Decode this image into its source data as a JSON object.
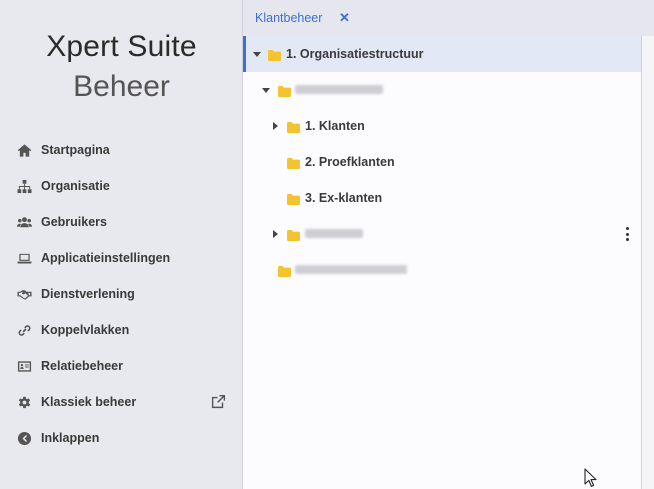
{
  "brand": {
    "line1": "Xpert Suite",
    "line2": "Beheer"
  },
  "nav": [
    {
      "id": "startpagina",
      "label": "Startpagina",
      "icon": "home-icon"
    },
    {
      "id": "organisatie",
      "label": "Organisatie",
      "icon": "sitemap-icon"
    },
    {
      "id": "gebruikers",
      "label": "Gebruikers",
      "icon": "users-icon"
    },
    {
      "id": "applicatieinstellingen",
      "label": "Applicatieinstellingen",
      "icon": "laptop-icon"
    },
    {
      "id": "dienstverlening",
      "label": "Dienstverlening",
      "icon": "handshake-icon"
    },
    {
      "id": "koppelvlakken",
      "label": "Koppelvlakken",
      "icon": "link-icon"
    },
    {
      "id": "relatiebeheer",
      "label": "Relatiebeheer",
      "icon": "id-card-icon"
    },
    {
      "id": "klassiek-beheer",
      "label": "Klassiek beheer",
      "icon": "gear-icon"
    },
    {
      "id": "inklappen",
      "label": "Inklappen",
      "icon": "chevron-left-circle-icon"
    }
  ],
  "tabs": [
    {
      "label": "Klantbeheer",
      "close": "✕"
    }
  ],
  "tree": {
    "root": {
      "label": "1. Organisatiestructuur"
    },
    "children": [
      {
        "label": "1. Klanten"
      },
      {
        "label": "2. Proefklanten"
      },
      {
        "label": "3. Ex-klanten"
      }
    ]
  },
  "colors": {
    "accent": "#3a6fd8",
    "folder": "#f4c430"
  }
}
